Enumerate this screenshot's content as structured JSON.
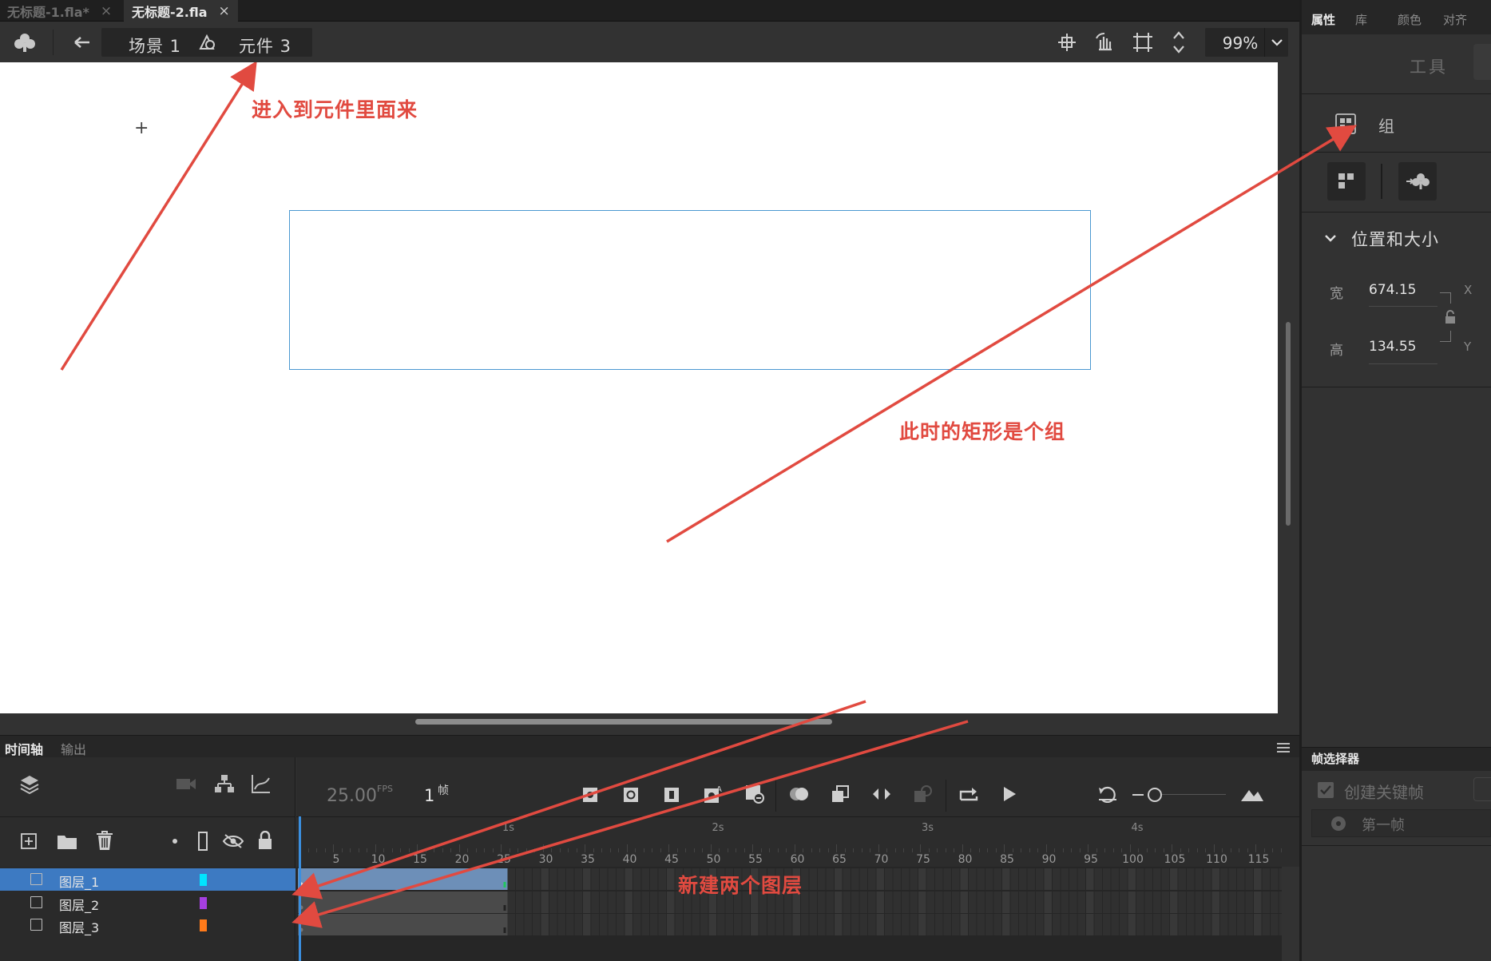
{
  "doc_tabs": [
    {
      "label": "无标题-1.fla*",
      "close": "×"
    },
    {
      "label": "无标题-2.fla",
      "close": "×"
    }
  ],
  "edit_bar": {
    "breadcrumb": [
      {
        "label": "场景 1"
      },
      {
        "label": "元件 3"
      }
    ],
    "zoom": "99%"
  },
  "stage": {
    "annotations": {
      "enter_symbol": "进入到元件里面来",
      "rect_is_group": "此时的矩形是个组",
      "new_layers": "新建两个图层"
    },
    "colors": {
      "rect_border": "#4b98d1",
      "annotation": "#e14a40"
    }
  },
  "timeline": {
    "tabs": [
      "时间轴",
      "输出"
    ],
    "fps": "25.00",
    "fps_unit": "FPS",
    "frame": "1",
    "frame_unit": "帧",
    "ruler_labels": [
      "5",
      "10",
      "15",
      "20",
      "25",
      "30",
      "35",
      "40",
      "45",
      "50",
      "55",
      "60",
      "65",
      "70",
      "75",
      "80",
      "85",
      "90",
      "95",
      "100",
      "105",
      "110",
      "115"
    ],
    "second_labels": [
      "1s",
      "2s",
      "3s",
      "4s"
    ],
    "layers": [
      {
        "name": "图层_1",
        "color": "#00e5ff",
        "selected": true
      },
      {
        "name": "图层_2",
        "color": "#a53fe0",
        "selected": false
      },
      {
        "name": "图层_3",
        "color": "#ff7a1a",
        "selected": false
      }
    ]
  },
  "right_panel": {
    "tabs": [
      "属性",
      "库",
      "颜色",
      "对齐"
    ],
    "tool_label": "工具",
    "object_type": "组",
    "section_title": "位置和大小",
    "width_label": "宽",
    "width_value": "674.15",
    "height_label": "高",
    "height_value": "134.55",
    "x_label": "X",
    "y_label": "Y",
    "frame_picker": {
      "title": "帧选择器",
      "create_keyframe": "创建关键帧",
      "first_frame": "第一帧"
    }
  }
}
